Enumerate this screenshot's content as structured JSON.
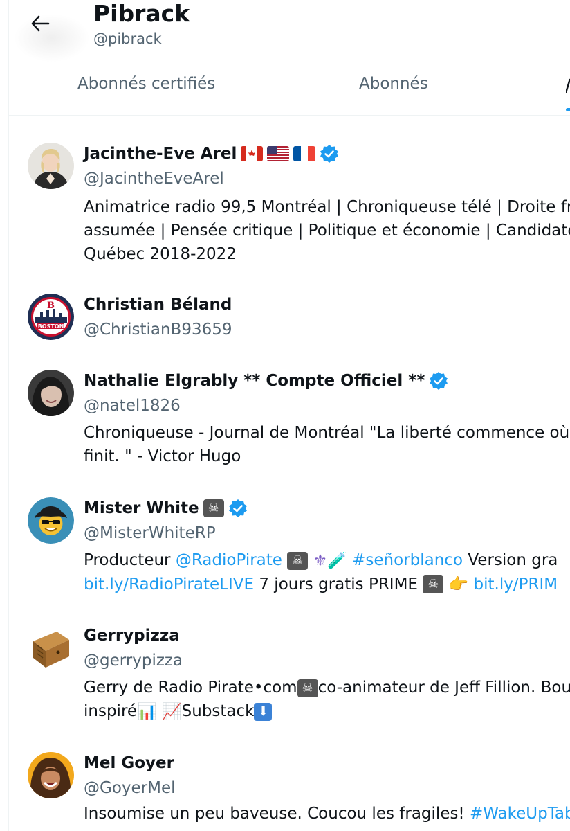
{
  "header": {
    "title": "Pibrack",
    "handle": "@pibrack"
  },
  "tabs": [
    {
      "label": "Abonnés certifiés"
    },
    {
      "label": "Abonnés"
    }
  ],
  "users": [
    {
      "name": "Jacinthe-Eve Arel",
      "handle": "@JacintheEveArel",
      "verified": true,
      "bio_lines": [
        "Animatrice radio 99,5 Montréal | Chroniqueuse télé | Droite fra",
        "assumée | Pensée critique | Politique et économie | Candidate",
        "Québec 2018-2022"
      ]
    },
    {
      "name": "Christian Béland",
      "handle": "@ChristianB93659",
      "verified": false,
      "avatar_text": "BOSTON"
    },
    {
      "name": "Nathalie Elgrably ** Compte Officiel **",
      "handle": "@natel1826",
      "verified": true,
      "bio_lines": [
        "Chroniqueuse - Journal de Montréal \"La liberté commence où",
        "finit. \" - Victor Hugo"
      ]
    },
    {
      "name": "Mister White",
      "handle": "@MisterWhiteRP",
      "verified": true,
      "bio": {
        "l1_a": "Producteur ",
        "l1_link": "@RadioPirate",
        "l1_hashtag": "#señorblanco",
        "l1_b": " Version gra",
        "l2_link1": "bit.ly/RadioPirateLIVE",
        "l2_text": " 7 jours gratis PRIME ",
        "l2_link2": "bit.ly/PRIM"
      }
    },
    {
      "name": "Gerrypizza",
      "handle": "@gerrypizza",
      "verified": false,
      "bio": {
        "l1_a": "Gerry de Radio Pirate•com",
        "l1_b": "co-animateur de Jeff Fillion. Bou",
        "l2_a": "inspiré",
        "l2_b": "Substack"
      }
    },
    {
      "name": "Mel Goyer",
      "handle": "@GoyerMel",
      "verified": false,
      "bio": {
        "text": "Insoumise un peu baveuse. Coucou les fragiles! ",
        "hashtag": "#WakeUpTab"
      }
    }
  ],
  "colors": {
    "accent": "#1d9bf0",
    "muted": "#536471",
    "text": "#0f1419"
  }
}
